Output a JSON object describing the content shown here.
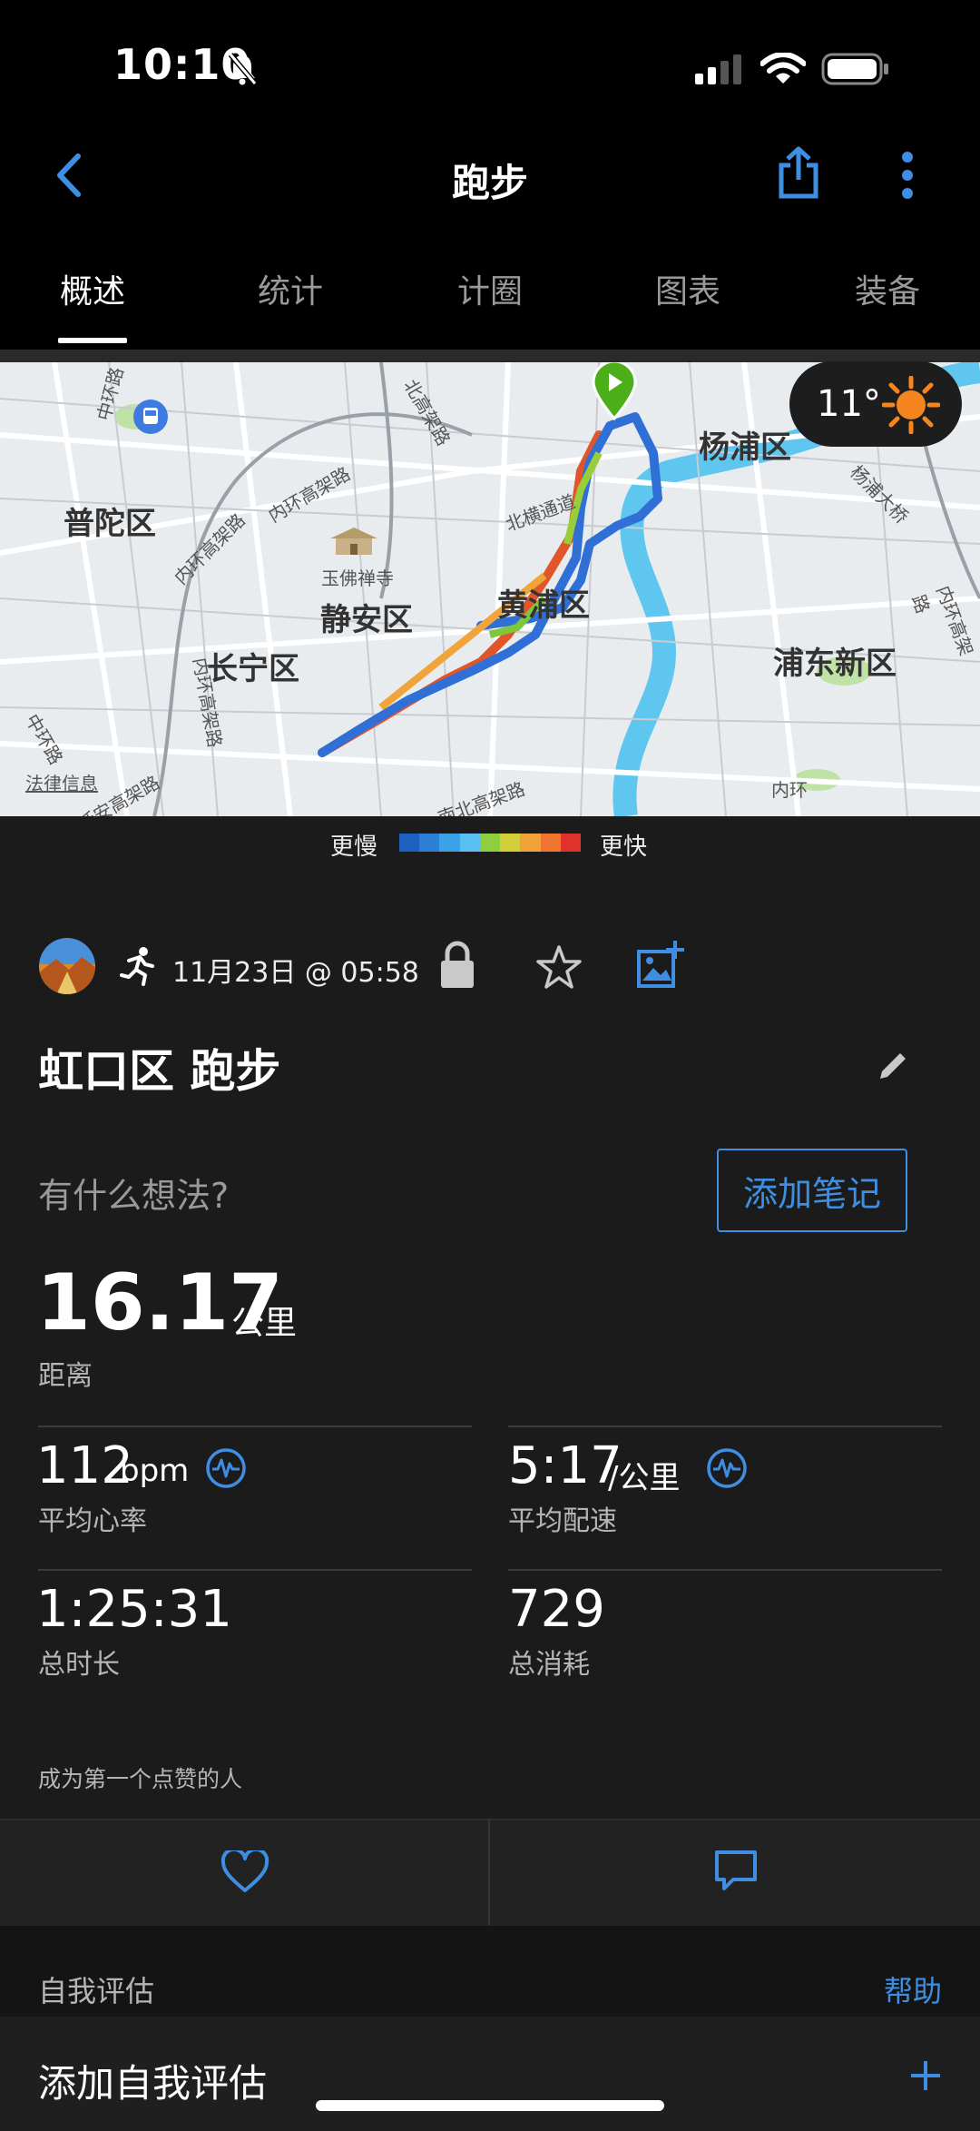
{
  "status_bar": {
    "time": "10:10"
  },
  "header": {
    "title": "跑步"
  },
  "tabs": [
    "概述",
    "统计",
    "计圈",
    "图表",
    "装备"
  ],
  "map": {
    "districts": [
      "杨浦区",
      "普陀区",
      "静安区",
      "黄浦区",
      "长宁区",
      "浦东新区"
    ],
    "roads": [
      "北高架路",
      "内环高架路",
      "北横通道",
      "中环路",
      "内环高架路",
      "内环高架路",
      "杨浦大桥",
      "内环高架路",
      "中环路",
      "延安高架路",
      "南北高架路",
      "内环"
    ],
    "poi": "玉佛禅寺",
    "legal": "法律信息",
    "weather_temp": "11°"
  },
  "legend": {
    "slow": "更慢",
    "fast": "更快",
    "colors": [
      "#1f5fbf",
      "#2c7fd6",
      "#3ba1e8",
      "#59c0ef",
      "#8dcf3f",
      "#d3cf3a",
      "#f2a23a",
      "#f1752e",
      "#e0322a"
    ]
  },
  "activity": {
    "datetime": "11月23日 @ 05:58",
    "title": "虹口区 跑步",
    "thoughts_prompt": "有什么想法?",
    "add_note": "添加笔记",
    "distance": {
      "value": "16.17",
      "unit": "公里",
      "label": "距离"
    },
    "stats": [
      {
        "value": "112",
        "unit": "bpm",
        "label": "平均心率"
      },
      {
        "value": "5:17",
        "unit": "/公里",
        "label": "平均配速"
      },
      {
        "value": "1:25:31",
        "unit": "",
        "label": "总时长"
      },
      {
        "value": "729",
        "unit": "",
        "label": "总消耗"
      }
    ],
    "likes_prompt": "成为第一个点赞的人"
  },
  "self_eval": {
    "title": "自我评估",
    "help": "帮助",
    "add": "添加自我评估"
  },
  "colors": {
    "accent": "#3e8fe3",
    "start_marker": "#4caf1a"
  },
  "icons": [
    "back-icon",
    "share-icon",
    "more-icon",
    "transit-icon",
    "start-flag-icon",
    "sun-icon",
    "avatar",
    "running-icon",
    "lock-icon",
    "star-icon",
    "add-photo-icon",
    "edit-icon",
    "heart-rate-icon",
    "pace-icon",
    "heart-icon",
    "comment-icon",
    "plus-icon"
  ]
}
